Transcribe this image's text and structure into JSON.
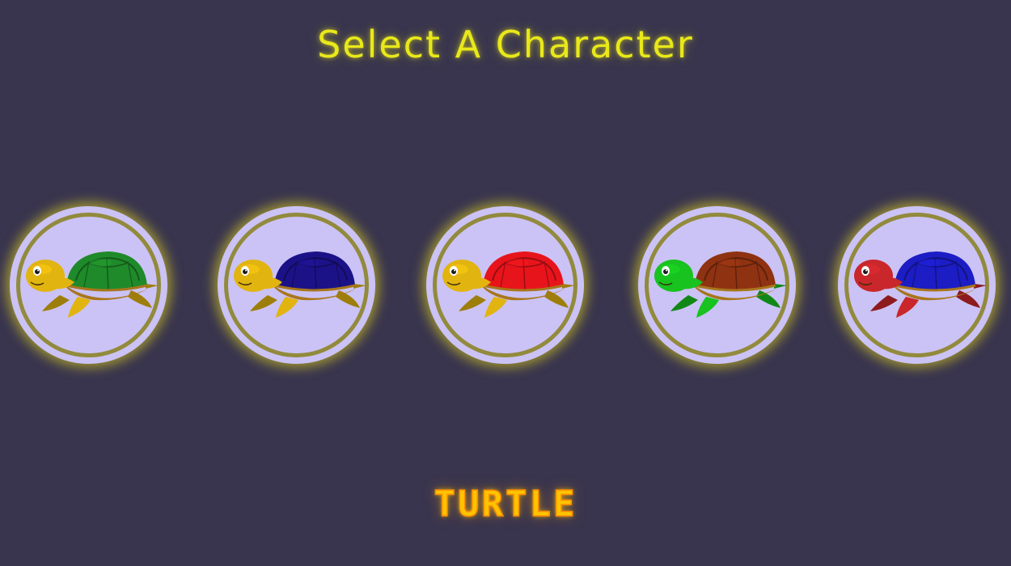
{
  "screen": {
    "title": "Select A Character",
    "selected_name": "TURTLE"
  },
  "colors": {
    "background": "#39354e",
    "title": "#e9e81a",
    "slot_fill": "#cbc3f5",
    "slot_ring": "#928a3c",
    "slot_glow": "#ebdc1e",
    "name_text": "#ffc400"
  },
  "characters": [
    {
      "icon": "turtle-icon",
      "body_color": "#e2b40f",
      "shell_color": "#1f8a2a"
    },
    {
      "icon": "turtle-icon",
      "body_color": "#e2b40f",
      "shell_color": "#1c1288"
    },
    {
      "icon": "turtle-icon",
      "body_color": "#e2b40f",
      "shell_color": "#e8141b"
    },
    {
      "icon": "turtle-icon",
      "body_color": "#18c21f",
      "shell_color": "#8f3212"
    },
    {
      "icon": "turtle-icon",
      "body_color": "#c9272b",
      "shell_color": "#1c1dc4"
    }
  ]
}
